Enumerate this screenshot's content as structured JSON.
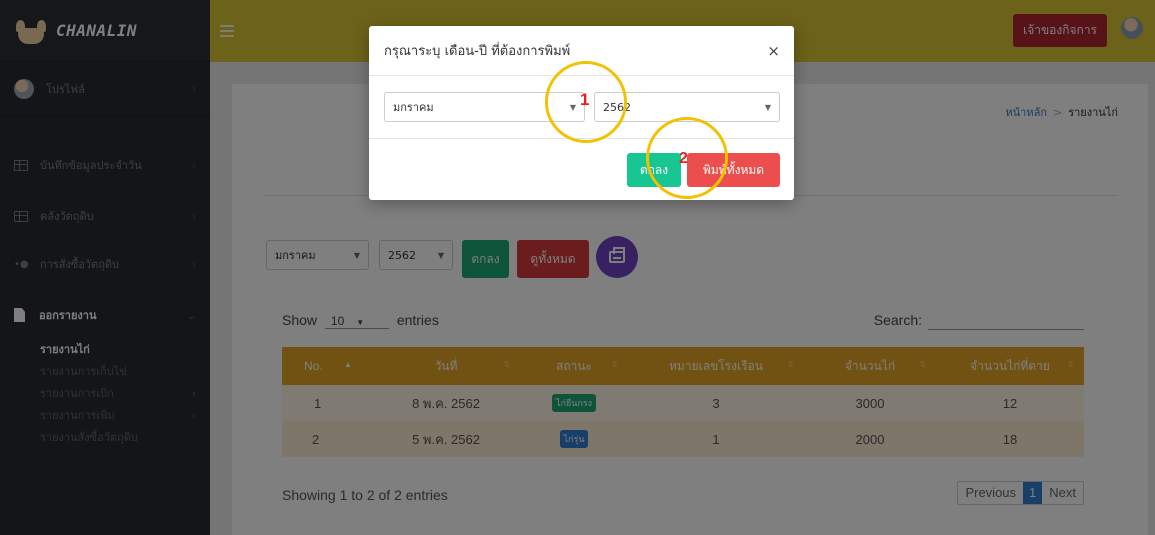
{
  "app": {
    "brand": "CHANALIN"
  },
  "sidebar": {
    "profile_label": "โปรไฟล์",
    "items": [
      {
        "label": "บันทึกข้อมูลประจำวัน"
      },
      {
        "label": "คลังวัตถุดิบ"
      },
      {
        "label": "การสั่งซื้อวัตถุดิบ"
      },
      {
        "label": "ออกรายงาน"
      }
    ],
    "report_sub": [
      {
        "label": "รายงานไก่"
      },
      {
        "label": "รายงานการเก็บไข่"
      },
      {
        "label": "รายงานการเบิก"
      },
      {
        "label": "รายงานการเพิ่ม"
      },
      {
        "label": "รายงานสั่งซื้อวัตถุดิบ"
      }
    ]
  },
  "header": {
    "owner_button": "เจ้าของกิจการ"
  },
  "breadcrumb": {
    "home": "หน้าหลัก",
    "current": "รายงานไก่"
  },
  "filter": {
    "month": "มกราคม",
    "year": "2562",
    "ok_label": "ตกลง",
    "view_all_label": "ดูทั้งหมด"
  },
  "datatable": {
    "show_label": "Show",
    "entries_label": "entries",
    "length_value": "10",
    "search_label": "Search:",
    "columns": [
      "No.",
      "วันที่",
      "สถานะ",
      "หมายเลขโรงเรือน",
      "จำนวนไก่",
      "จำนวนไก่ที่ตาย"
    ],
    "rows": [
      {
        "no": "1",
        "date": "8 พ.ค. 2562",
        "status": "ไก่ยืนกรง",
        "status_color": "#1aa877",
        "house": "3",
        "count": "3000",
        "dead": "12"
      },
      {
        "no": "2",
        "date": "5 พ.ค. 2562",
        "status": "ไก่รุ่น",
        "status_color": "#2f7fd3",
        "house": "1",
        "count": "2000",
        "dead": "18"
      }
    ],
    "info": "Showing 1 to 2 of 2 entries",
    "prev": "Previous",
    "page": "1",
    "next": "Next"
  },
  "modal": {
    "title": "กรุณาระบุ เดือน-ปี ที่ต้องการพิมพ์",
    "close": "×",
    "month": "มกราคม",
    "year": "2562",
    "ok_label": "ตกลง",
    "print_all_label": "พิมพ์ทั้งหมด"
  },
  "annotations": {
    "step1": "1",
    "step2": "2"
  },
  "colors": {
    "topbar": "#d8c533",
    "sidebar": "#272b30",
    "table_header": "#e4a424",
    "green": "#1aa877",
    "red": "#d63a3a",
    "purple": "#6f42c1",
    "callout": "#f2c100"
  }
}
